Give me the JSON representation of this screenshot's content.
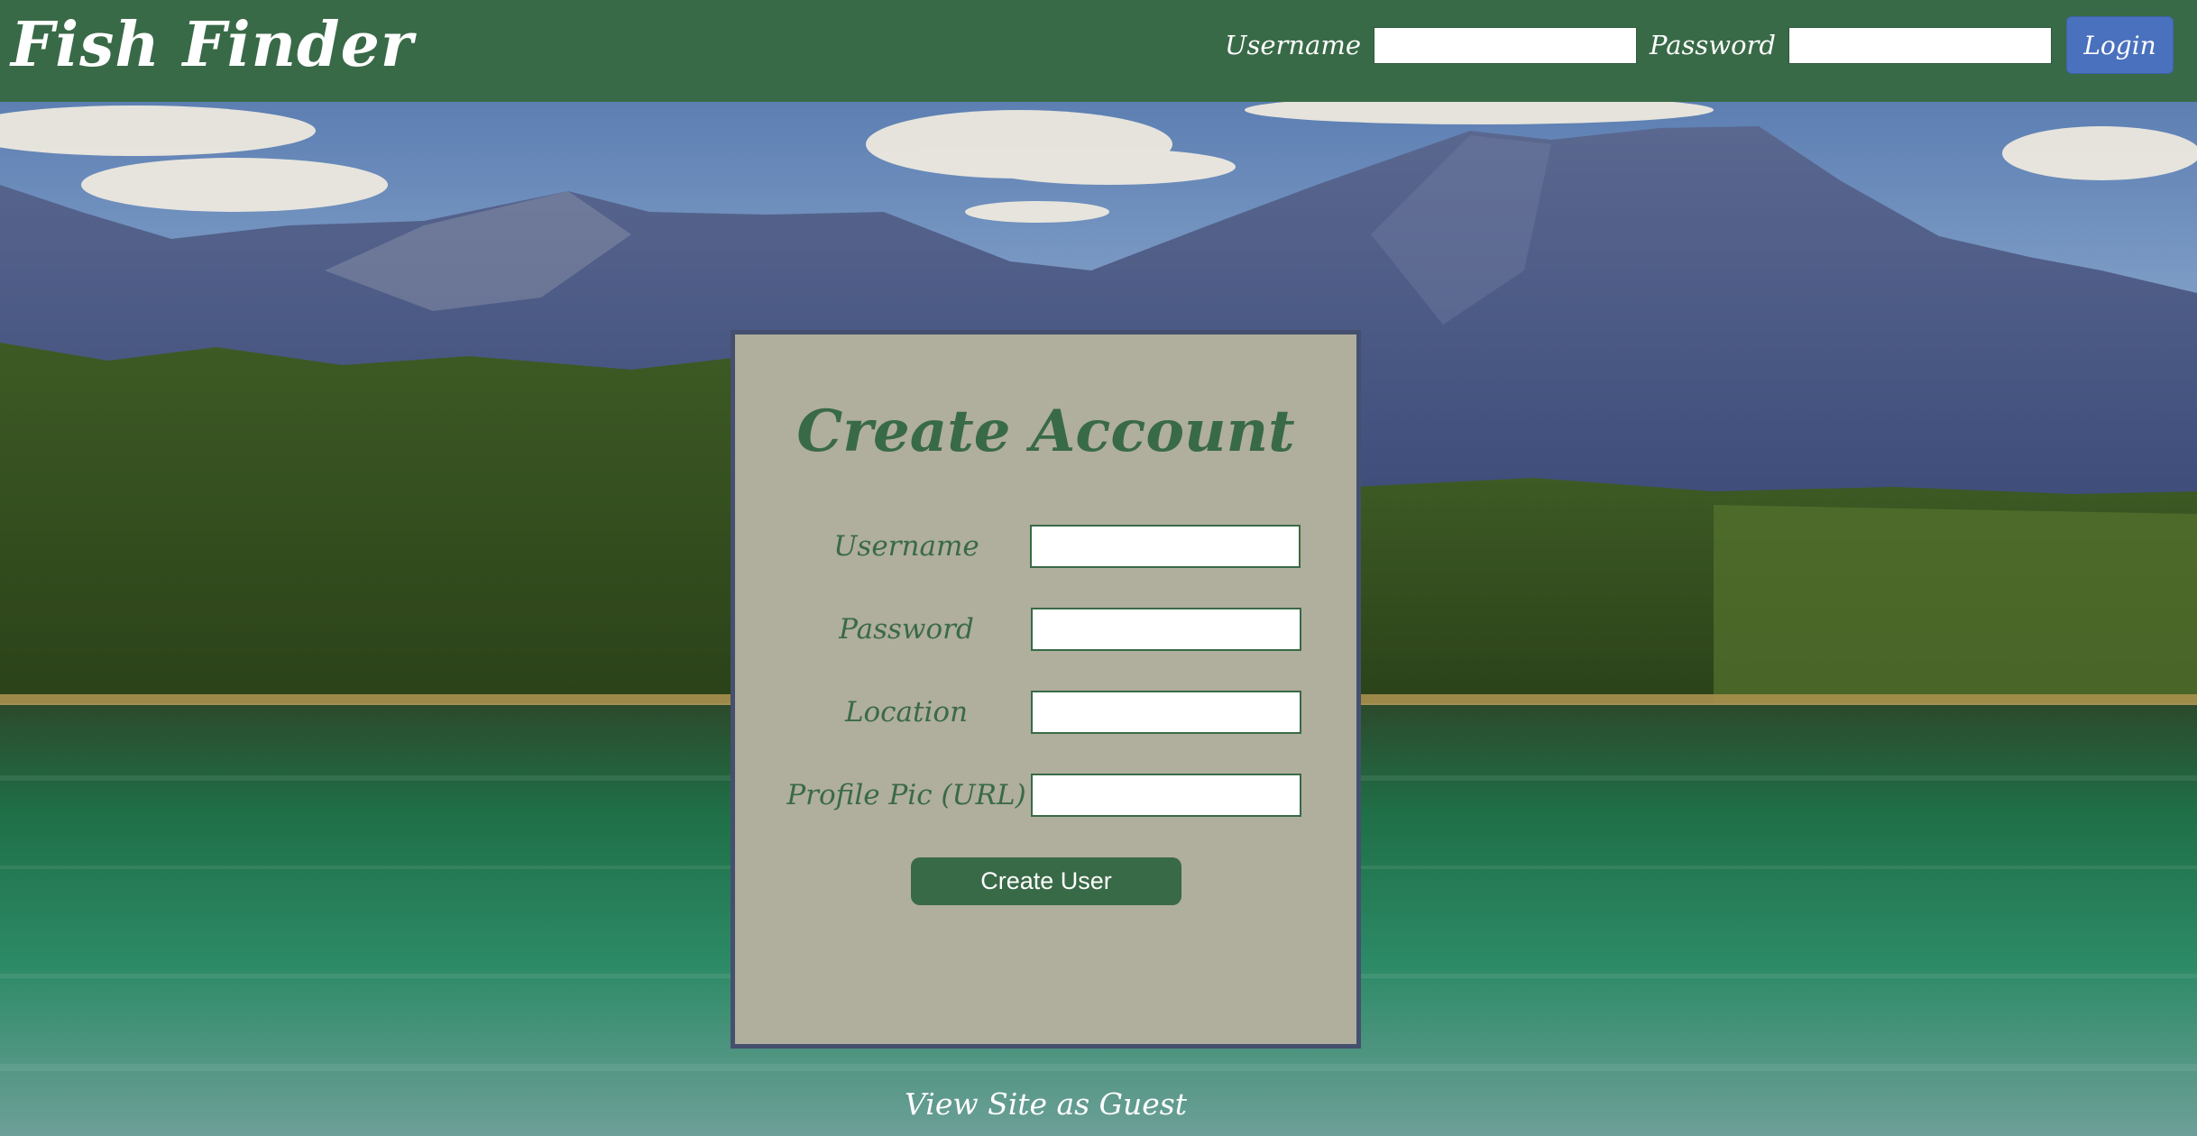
{
  "header": {
    "brand": "Fish Finder",
    "username_label": "Username",
    "password_label": "Password",
    "username_value": "",
    "password_value": "",
    "login_label": "Login"
  },
  "form": {
    "title": "Create Account",
    "fields": [
      {
        "label": "Username",
        "value": ""
      },
      {
        "label": "Password",
        "value": ""
      },
      {
        "label": "Location",
        "value": ""
      },
      {
        "label": "Profile Pic (URL)",
        "value": ""
      }
    ],
    "submit_label": "Create User"
  },
  "guest_link": "View Site as Guest",
  "colors": {
    "header_green": "#396a47",
    "card_background": "#b0ae9c",
    "card_border": "#44506e",
    "login_button_blue": "#4a71be",
    "text_white": "#ffffff"
  }
}
